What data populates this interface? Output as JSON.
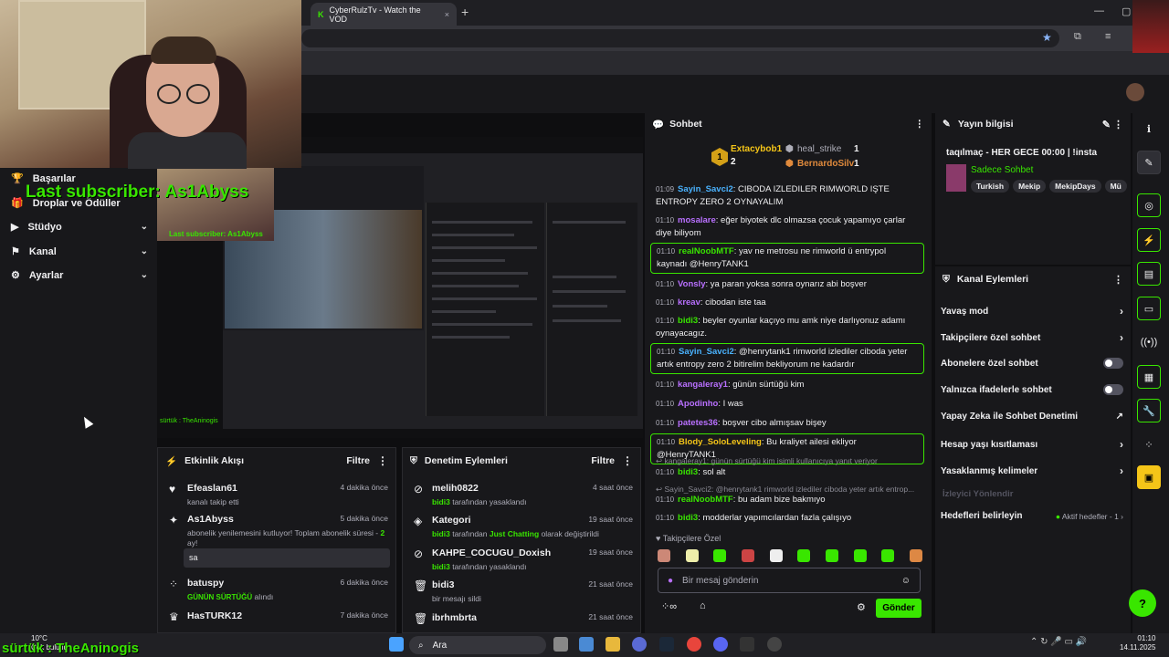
{
  "browser": {
    "tab_title": "CyberRulzTv - Watch the VOD",
    "close": "×",
    "new_tab": "+"
  },
  "window_controls": {
    "min": "—",
    "max": "▢"
  },
  "overlay": {
    "last_subscriber": "Last subscriber: As1Abyss",
    "bottom_ticker": "sürtük : TheAninogis"
  },
  "sidebar": {
    "items": [
      {
        "label": "Başarılar"
      },
      {
        "label": "Droplar ve Ödüller"
      },
      {
        "label": "Stüdyo"
      },
      {
        "label": "Kanal"
      },
      {
        "label": "Ayarlar"
      }
    ]
  },
  "nested": {
    "last_subscriber": "Last subscriber: As1Abyss",
    "ticker": "sürtük : TheAninogis"
  },
  "activity_feed": {
    "title": "Etkinlik Akışı",
    "filter": "Filtre",
    "items": [
      {
        "name": "Efeaslan61",
        "time": "4 dakika önce",
        "desc": "kanalı takip etti"
      },
      {
        "name": "As1Abyss",
        "time": "5 dakika önce",
        "desc": "abonelik yenilemesini kutluyor! Toplam abonelik süresi -",
        "highlight": "2",
        "desc_end": "ay!",
        "message": "sa"
      },
      {
        "name": "batuspy",
        "time": "6 dakika önce",
        "highlight": "GÜNÜN SÜRTÜĞÜ",
        "desc": "alındı"
      },
      {
        "name": "HasTURK12",
        "time": "7 dakika önce"
      }
    ]
  },
  "mod_actions": {
    "title": "Denetim Eylemleri",
    "filter": "Filtre",
    "items": [
      {
        "name": "melih0822",
        "time": "4 saat önce",
        "actor": "bidi3",
        "desc": "tarafından yasaklandı"
      },
      {
        "name": "Kategori",
        "time": "19 saat önce",
        "actor": "bidi3",
        "desc_pre": "tarafından",
        "highlight": "Just Chatting",
        "desc": "olarak değiştirildi"
      },
      {
        "name": "KAHPE_COCUGU_Doxish",
        "time": "19 saat önce",
        "actor": "bidi3",
        "desc": "tarafından yasaklandı"
      },
      {
        "name": "bidi3",
        "time": "21 saat önce",
        "desc": "bir mesajı sildi"
      },
      {
        "name": "ibrhmbrta",
        "time": "21 saat önce"
      }
    ]
  },
  "chat": {
    "title": "Sohbet",
    "gifters": [
      {
        "rank": "1",
        "name": "Extacybob1",
        "count": "2",
        "color": "#f5c518"
      },
      {
        "name": "heal_strike",
        "count": "1",
        "color": "#adadb8"
      },
      {
        "name": "BernardoSilv",
        "count": "1",
        "color": "#e08a3c"
      }
    ],
    "messages": [
      {
        "time": "01:09",
        "user": "Sayin_Savci2",
        "color": "#4ab3ff",
        "text": "CIBODA IZLEDILER RIMWORLD IŞTE ENTROPY ZERO 2 OYNAYALIM"
      },
      {
        "time": "01:10",
        "user": "mosalare",
        "color": "#b970ff",
        "text": "eğer biyotek dlc olmazsa çocuk yapamıyo çarlar diye biliyom"
      },
      {
        "time": "01:10",
        "user": "realNoobMTF",
        "color": "#39e600",
        "text": "yav ne metrosu ne rimworld ü entrypol kaynadı @HenryTANK1"
      },
      {
        "time": "01:10",
        "user": "Vonsly",
        "color": "#b970ff",
        "text": "ya paran yoksa sonra oynarız abi boşver"
      },
      {
        "time": "01:10",
        "user": "kreav",
        "color": "#b970ff",
        "text": "cibodan iste taa"
      },
      {
        "time": "01:10",
        "user": "bidi3",
        "color": "#39e600",
        "text": "beyler oyunlar kaçıyo mu amk niye darlıyonuz adamı oynayacagız."
      },
      {
        "time": "01:10",
        "user": "Sayin_Savci2",
        "color": "#4ab3ff",
        "text": "@henrytank1 rimworld izlediler ciboda yeter artık entropy zero 2 bitirelim bekliyorum ne kadardır"
      },
      {
        "time": "01:10",
        "user": "kangaleray1",
        "color": "#b970ff",
        "text": "günün sürtüğü kim"
      },
      {
        "time": "01:10",
        "user": "Apodinho",
        "color": "#b970ff",
        "text": "I was"
      },
      {
        "time": "01:10",
        "user": "patetes36",
        "color": "#b970ff",
        "text": "boşver cibo almışsav bişey"
      },
      {
        "time": "01:10",
        "user": "Blody_SoloLeveling",
        "color": "#f5c518",
        "text": "Bu kraliyet ailesi ekliyor @HenryTANK1"
      },
      {
        "reply": "kangaleray1: günün sürtüğü kim isimli kullanıcıya yanıt veriyor"
      },
      {
        "time": "01:10",
        "user": "bidi3",
        "color": "#39e600",
        "text": "sol alt"
      },
      {
        "reply": "Sayin_Savci2: @henrytank1 rimworld izlediler ciboda yeter artık entrop..."
      },
      {
        "time": "01:10",
        "user": "realNoobMTF",
        "color": "#39e600",
        "text": "bu adam bize bakmıyo"
      },
      {
        "time": "01:10",
        "user": "bidi3",
        "color": "#39e600",
        "text": "modderlar yapımcılardan fazla çalışıyo"
      }
    ],
    "follower_label": "Takipçilere Özel",
    "input_placeholder": "Bir mesaj gönderin",
    "send": "Gönder"
  },
  "stream_info": {
    "title": "Yayın bilgisi",
    "stream_title": "taqılmaç - HER GECE 00:00 | !insta",
    "category": "Sadece Sohbet",
    "tags": [
      "Turkish",
      "Mekip",
      "MekipDays",
      "Mü"
    ]
  },
  "channel_actions": {
    "title": "Kanal Eylemleri",
    "items": [
      {
        "label": "Yavaş mod",
        "type": "arrow"
      },
      {
        "label": "Takipçilere özel sohbet",
        "type": "arrow"
      },
      {
        "label": "Abonelere özel sohbet",
        "type": "toggle"
      },
      {
        "label": "Yalnızca ifadelerle sohbet",
        "type": "toggle"
      },
      {
        "label": "Yapay Zeka ile Sohbet Denetimi",
        "type": "ext"
      },
      {
        "label": "Hesap yaşı kısıtlaması",
        "type": "arrow"
      },
      {
        "label": "Yasaklanmış kelimeler",
        "type": "arrow"
      }
    ],
    "section": "İzleyici Yönlendir",
    "goals": "Hedefleri belirleyin",
    "goals_status": "Aktif hedefler - 1"
  },
  "taskbar": {
    "search": "Ara",
    "time": "01:10",
    "date": "14.11.2025",
    "temp": "10°C",
    "weather": "Çok bulutlu"
  }
}
